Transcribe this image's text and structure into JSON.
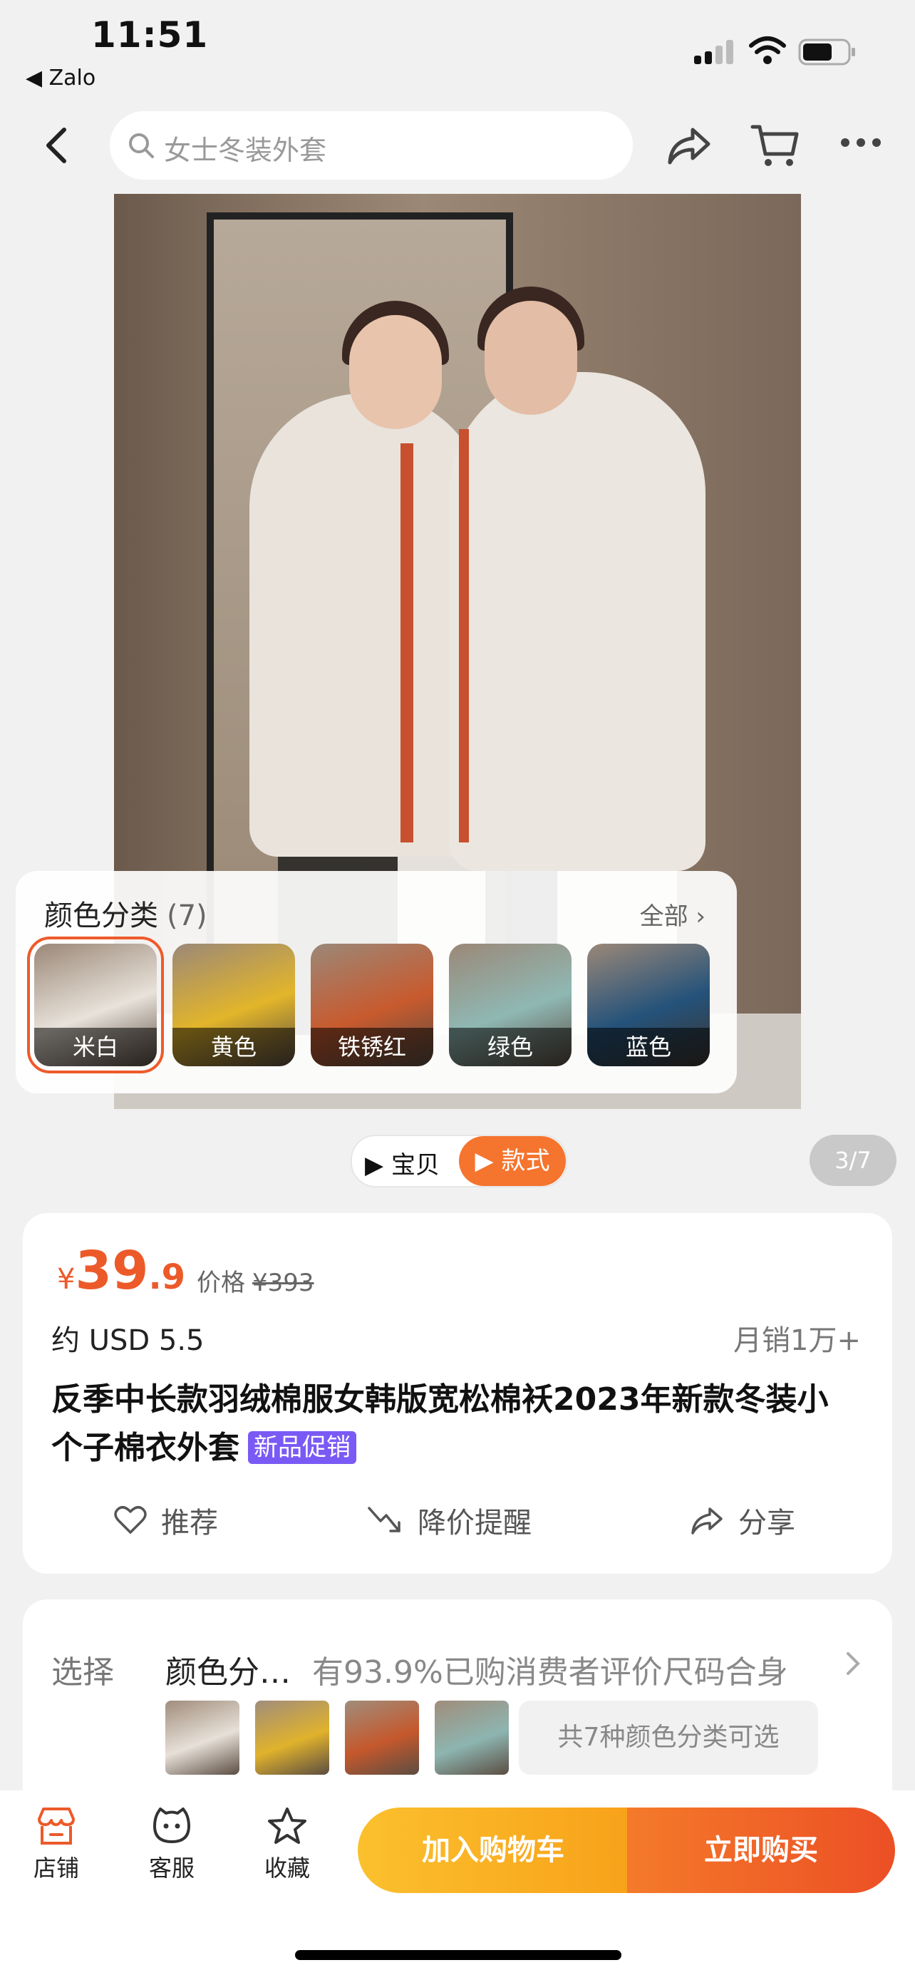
{
  "status_bar": {
    "time": "11:51",
    "back_app": "◀ Zalo"
  },
  "nav": {
    "search_placeholder": "女士冬装外套"
  },
  "color_panel": {
    "title": "颜色分类",
    "count": "(7)",
    "all_label": "全部 ›",
    "swatches": [
      {
        "label": "米白",
        "color": "#e8e2da"
      },
      {
        "label": "黄色",
        "color": "#e2b52a"
      },
      {
        "label": "铁锈红",
        "color": "#c85a2e"
      },
      {
        "label": "绿色",
        "color": "#8fb8b3"
      },
      {
        "label": "蓝色",
        "color": "#24527a"
      }
    ]
  },
  "media_switcher": {
    "tab_video": "▶ 宝贝",
    "tab_style": "▶ 款式"
  },
  "pager": "3/7",
  "price": {
    "currency": "¥",
    "integer": "39",
    "decimal": ".9",
    "orig_label": "价格",
    "orig_price": "¥393",
    "usd": "约 USD 5.5",
    "monthly_sales": "月销1万+"
  },
  "product": {
    "title": "反季中长款羽绒棉服女韩版宽松棉袄2023年新款冬装小个子棉衣外套",
    "badge": "新品促销"
  },
  "actions": {
    "recommend": "推荐",
    "price_alert": "降价提醒",
    "share": "分享"
  },
  "selection": {
    "label": "选择",
    "value": "颜色分…",
    "note": "有93.9%已购消费者评价尺码合身",
    "thumbs": [
      "#e7e0d8",
      "#e0b22c",
      "#c5582c",
      "#8db5b0"
    ],
    "count_text": "共7种颜色分类可选"
  },
  "bottom": {
    "store": "店铺",
    "service": "客服",
    "favorite": "收藏",
    "add_cart": "加入购物车",
    "buy_now": "立即购买"
  },
  "colors": {
    "accent": "#ec5a2a",
    "badge": "#7a5af5"
  }
}
